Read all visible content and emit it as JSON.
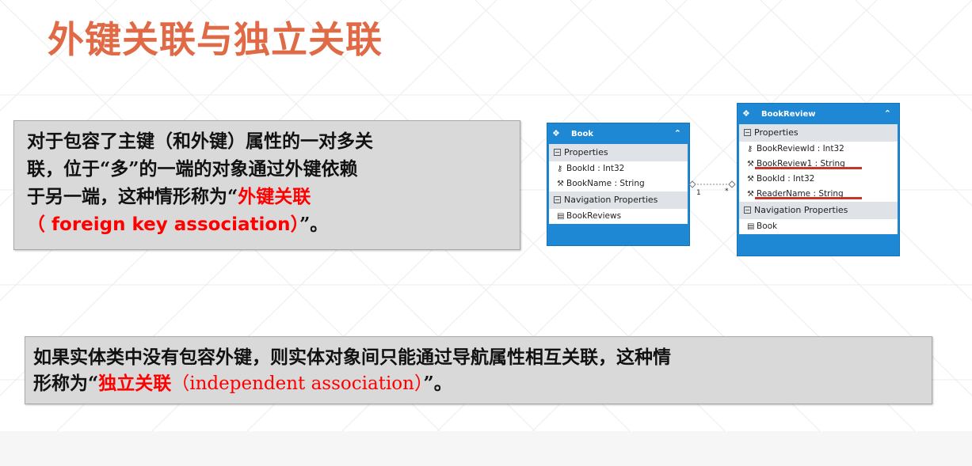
{
  "title": "外键关联与独立关联",
  "note1": {
    "line1": "对于包容了主键（和外键）属性的一对多关",
    "line2": "联，位于“多”的一端的对象通过外键依赖",
    "line3_prefix": "于另一端，这种情形称为“",
    "line3_red": "外键关联",
    "line4_open": "（",
    "line4_red": " foreign key association",
    "line4_close": "）",
    "line4_suffix": "”。"
  },
  "note2": {
    "line1": "如果实体类中没有包容外键，则实体对象间只能通过导航属性相互关联，这种情",
    "line2_prefix": "形称为“",
    "line2_red_cn": "独立关联",
    "line2_red_en": "（independent association）",
    "line2_suffix": "”。"
  },
  "diagram": {
    "book": {
      "name": "Book",
      "properties_label": "Properties",
      "properties": [
        "BookId : Int32",
        "BookName : String"
      ],
      "nav_label": "Navigation Properties",
      "nav": [
        "BookReviews"
      ]
    },
    "review": {
      "name": "BookReview",
      "properties_label": "Properties",
      "properties": [
        "BookReviewId : Int32",
        "BookReview1 : String",
        "BookId : Int32",
        "ReaderName : String"
      ],
      "nav_label": "Navigation Properties",
      "nav": [
        "Book"
      ]
    },
    "mult_one": "1",
    "mult_many": "*"
  },
  "colors": {
    "title": "#e06a45",
    "highlight": "#ff0000",
    "entity_header": "#1e88d4",
    "underline": "#c0392b"
  },
  "icons": {
    "entity": "entity-icon",
    "key": "key-icon",
    "wrench": "wrench-icon",
    "navigation": "navigation-property-icon",
    "collapse": "chevron-up-icon"
  }
}
